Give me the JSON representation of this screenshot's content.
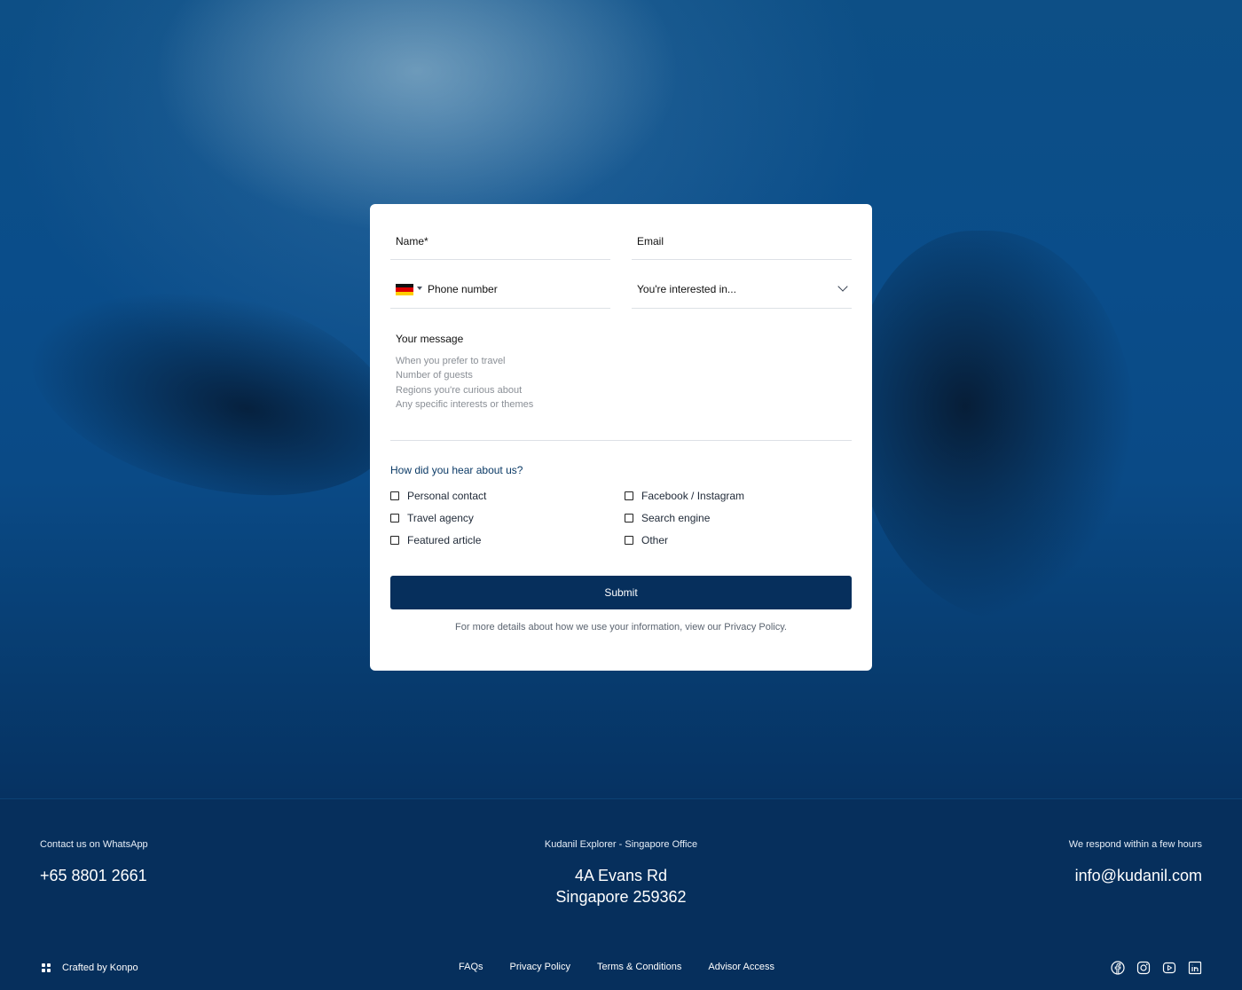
{
  "form": {
    "name_label": "Name*",
    "email_label": "Email",
    "phone_label": "Phone number",
    "interest_label": "You're interested in...",
    "message_label": "Your message",
    "message_placeholder_lines": [
      "When you prefer to travel",
      "Number of guests",
      "Regions you're curious about",
      "Any specific interests or themes"
    ],
    "hear_title": "How did you hear about us?",
    "checkboxes": [
      "Personal contact",
      "Travel agency",
      "Featured article",
      "Facebook / Instagram",
      "Search engine",
      "Other"
    ],
    "submit_label": "Submit",
    "privacy_note": "For more details about how we use your information, view our Privacy Policy."
  },
  "footer": {
    "whatsapp_label": "Contact us on WhatsApp",
    "phone": "+65 8801 2661",
    "office_label": "Kudanil Explorer - Singapore Office",
    "address_line1": "4A Evans Rd",
    "address_line2": "Singapore 259362",
    "respond_label": "We respond within a few hours",
    "email": "info@kudanil.com",
    "crafted": "Crafted by Konpo",
    "links": [
      "FAQs",
      "Privacy Policy",
      "Terms & Conditions",
      "Advisor Access"
    ],
    "socials": [
      "facebook-icon",
      "instagram-icon",
      "youtube-icon",
      "linkedin-icon"
    ]
  },
  "colors": {
    "primary": "#062f5c",
    "accent_text": "#0b3a66",
    "card_bg": "#ffffff"
  }
}
